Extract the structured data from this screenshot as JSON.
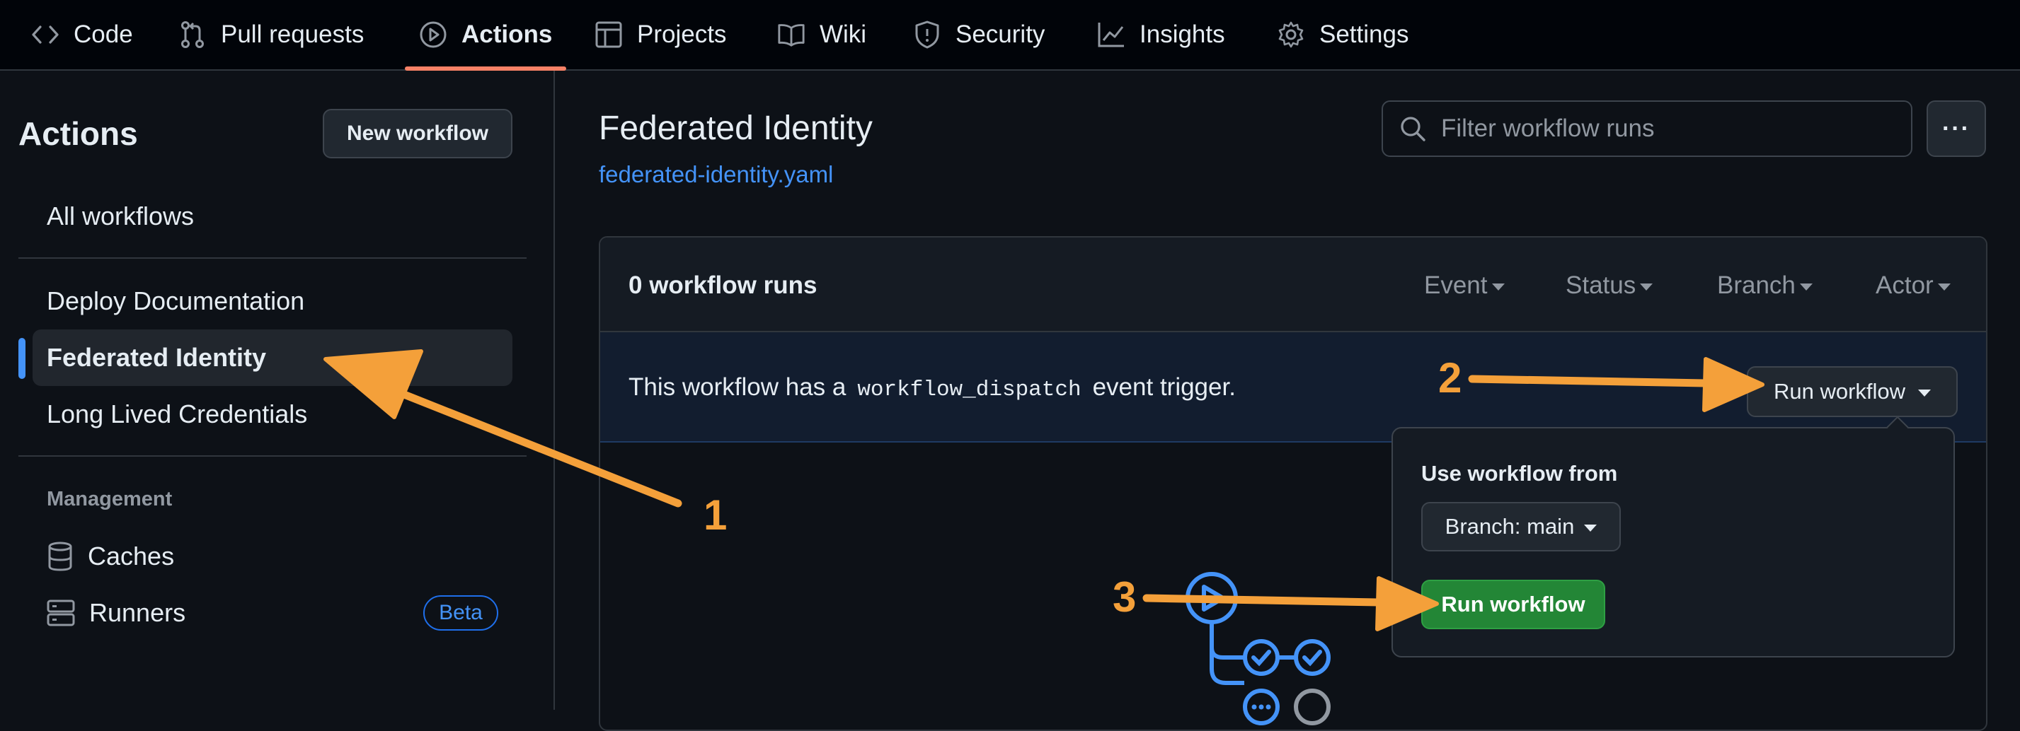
{
  "nav": {
    "tabs": [
      {
        "label": "Code",
        "icon": "code-icon"
      },
      {
        "label": "Pull requests",
        "icon": "git-pull-request-icon"
      },
      {
        "label": "Actions",
        "icon": "play-icon",
        "active": true
      },
      {
        "label": "Projects",
        "icon": "table-icon"
      },
      {
        "label": "Wiki",
        "icon": "book-icon"
      },
      {
        "label": "Security",
        "icon": "shield-icon"
      },
      {
        "label": "Insights",
        "icon": "graph-icon"
      },
      {
        "label": "Settings",
        "icon": "gear-icon"
      }
    ]
  },
  "sidebar": {
    "title": "Actions",
    "new_workflow": "New workflow",
    "all_workflows": "All workflows",
    "workflows": [
      {
        "label": "Deploy Documentation"
      },
      {
        "label": "Federated Identity",
        "active": true
      },
      {
        "label": "Long Lived Credentials"
      }
    ],
    "management_label": "Management",
    "management": [
      {
        "label": "Caches",
        "icon": "database-icon"
      },
      {
        "label": "Runners",
        "icon": "server-icon",
        "badge": "Beta"
      }
    ]
  },
  "main": {
    "title": "Federated Identity",
    "file": "federated-identity.yaml",
    "filter_placeholder": "Filter workflow runs",
    "more_label": "···",
    "runs_count": "0 workflow runs",
    "filters": [
      "Event",
      "Status",
      "Branch",
      "Actor"
    ],
    "dispatch": {
      "prefix": "This workflow has a",
      "code": "workflow_dispatch",
      "suffix": "event trigger."
    },
    "run_workflow": "Run workflow"
  },
  "popover": {
    "label": "Use workflow from",
    "branch": "Branch: main",
    "run_button": "Run workflow"
  },
  "annotations": {
    "color": "#f4a03a",
    "numbers": [
      "1",
      "2",
      "3"
    ]
  },
  "colors": {
    "accent_underline": "#f78166",
    "link": "#4493f8",
    "primary_button": "#238636"
  }
}
